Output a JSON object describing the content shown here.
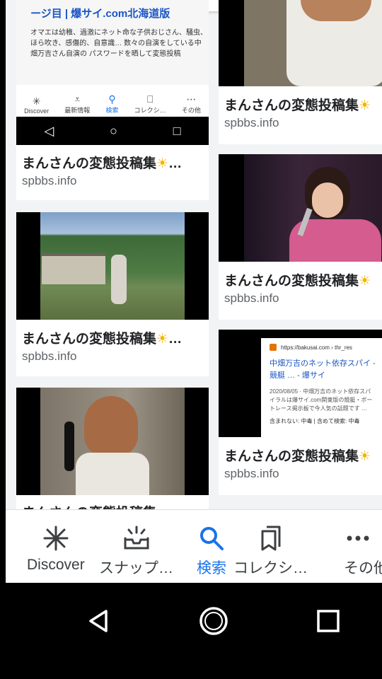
{
  "results": [
    {
      "title": "まんさんの変態投稿集",
      "domain": "spbbs.info",
      "thumb": {
        "heading": "ージ目 | 爆サイ.com北海道版",
        "body": "オマエは幼稚、過激にネット命な子供おじさん、騒虫、ほら吹き、感傷的、自意識… 数々の自演をしている中畑万吉さん自演の パスワードを晒して変態投稿",
        "nav": [
          "Discover",
          "最新情報",
          "検索",
          "コレクシ…",
          "その他"
        ],
        "nav_icons": [
          "✳",
          "⩡",
          "⚲",
          "⎕",
          "⋯"
        ]
      }
    },
    {
      "title": "まんさんの変態投稿集",
      "domain": "spbbs.info"
    },
    {
      "title": "まんさんの変態投稿集",
      "domain": "spbbs.info"
    },
    {
      "title": "まんさんの変態投稿集",
      "domain": "spbbs.info"
    },
    {
      "title": "まんさんの変態投稿集",
      "domain": "spbbs.info"
    },
    {
      "title": "まんさんの変態投稿集",
      "domain": "spbbs.info"
    },
    {
      "title": "まんさんの変態投稿集",
      "domain": "spbbs.info",
      "thumb": {
        "url": "https://bakusai.com › thr_res",
        "title": "中畑万吉のネット依存スパイ - 競艇 … - 爆サイ",
        "body": "2020/08/05 · 中畑万吉のネット依存スパイラルは爆サイ.com関東版の競艇・ボートレース掲示板で今人気の話題です …",
        "minus": "含まれない: 中毒 | 含めて検索: 中毒"
      }
    }
  ],
  "partial_title": "まんさんの変態投稿集",
  "ellipsis": "…",
  "sparkle": "☀",
  "bottom_nav": [
    {
      "label": "Discover",
      "icon": "asterisk-icon"
    },
    {
      "label": "スナップ…",
      "icon": "inbox-icon"
    },
    {
      "label": "検索",
      "icon": "search-icon",
      "active": true
    },
    {
      "label": "コレクシ…",
      "icon": "collections-icon"
    },
    {
      "label": "その他",
      "icon": "more-icon"
    }
  ],
  "colors": {
    "active": "#1a73e8",
    "text": "#202124",
    "domain": "#5f6368"
  }
}
